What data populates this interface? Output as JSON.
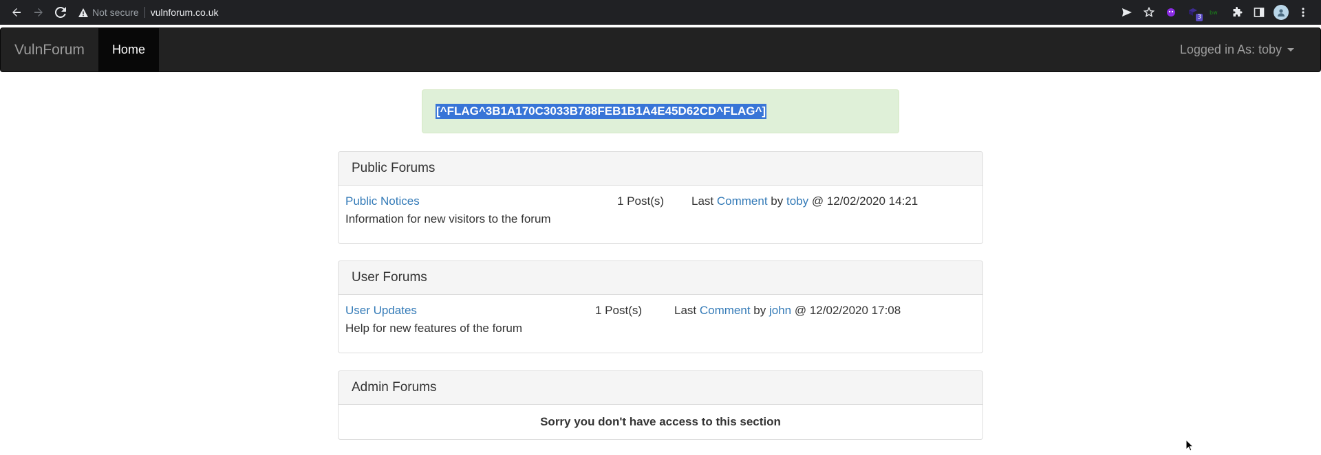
{
  "browser": {
    "security_label": "Not secure",
    "url": "vulnforum.co.uk",
    "extension_badge": "3"
  },
  "navbar": {
    "brand": "VulnForum",
    "home": "Home",
    "user_label": "Logged in As: toby"
  },
  "alert": {
    "flag": "[^FLAG^3B1A170C3033B788FEB1B1A4E45D62CD^FLAG^]"
  },
  "panels": [
    {
      "heading": "Public Forums",
      "forum_link": "Public Notices",
      "description": "Information for new visitors to the forum",
      "posts": "1 Post(s)",
      "last_prefix": "Last",
      "last_link": "Comment",
      "by_word": "by",
      "author": "toby",
      "timestamp": "@ 12/02/2020 14:21"
    },
    {
      "heading": "User Forums",
      "forum_link": "User Updates",
      "description": "Help for new features of the forum",
      "posts": "1 Post(s)",
      "last_prefix": "Last",
      "last_link": "Comment",
      "by_word": "by",
      "author": "john",
      "timestamp": "@ 12/02/2020 17:08"
    },
    {
      "heading": "Admin Forums",
      "message": "Sorry you don't have access to this section"
    }
  ]
}
